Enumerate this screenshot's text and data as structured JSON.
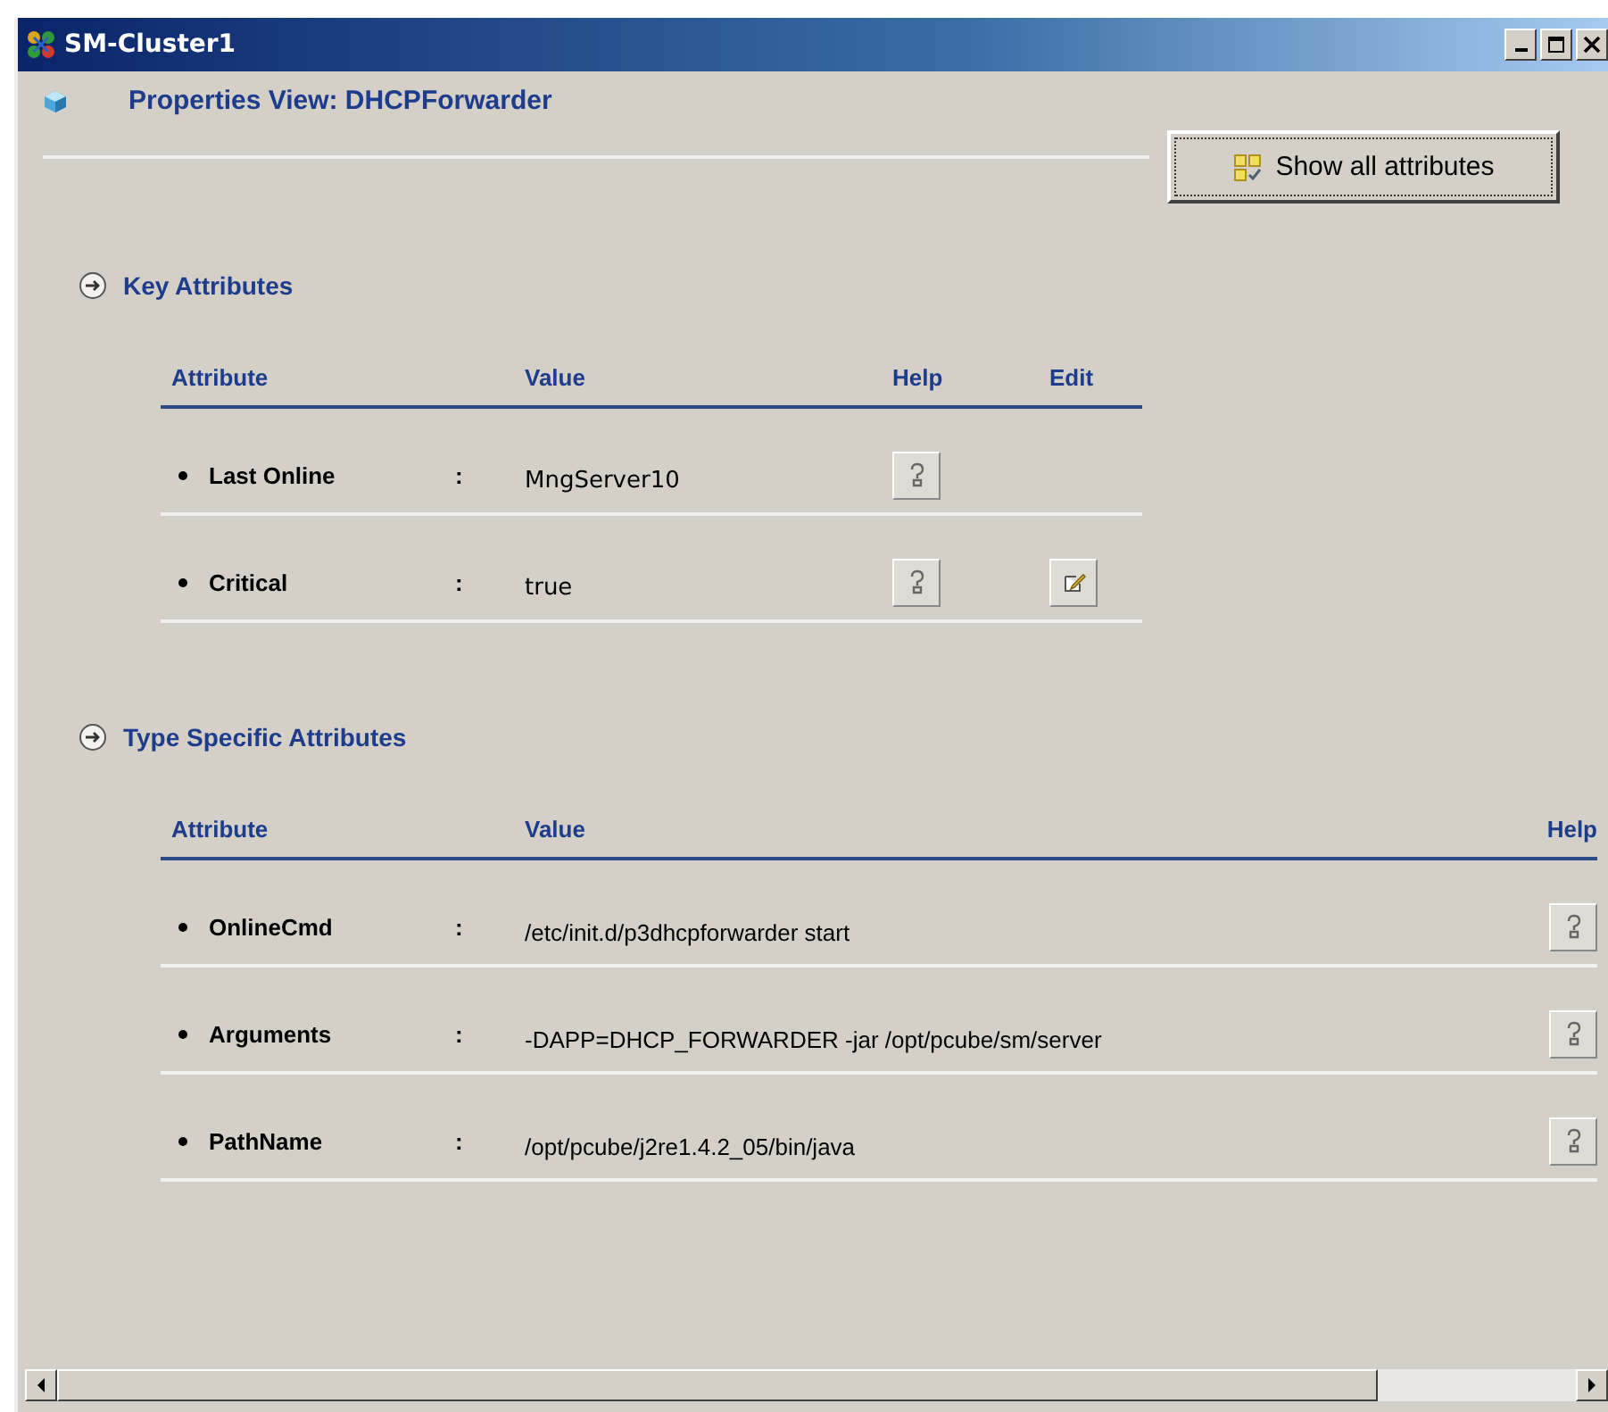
{
  "window": {
    "title": "SM-Cluster1"
  },
  "view_title": "Properties View:  DHCPForwarder",
  "show_all_button": "Show all attributes",
  "sections": [
    {
      "title": "Key Attributes",
      "columns": [
        "Attribute",
        "Value",
        "Help",
        "Edit"
      ],
      "rows": [
        {
          "attribute": "Last Online",
          "separator": ":",
          "value": "MngServer10",
          "editable": false
        },
        {
          "attribute": "Critical",
          "separator": ":",
          "value": "true",
          "editable": true
        }
      ]
    },
    {
      "title": "Type Specific Attributes",
      "columns": [
        "Attribute",
        "Value",
        "Help"
      ],
      "rows": [
        {
          "attribute": "OnlineCmd",
          "separator": ":",
          "value": "/etc/init.d/p3dhcpforwarder start"
        },
        {
          "attribute": "Arguments",
          "separator": ":",
          "value": "-DAPP=DHCP_FORWARDER -jar /opt/pcube/sm/server"
        },
        {
          "attribute": "PathName",
          "separator": ":",
          "value": "/opt/pcube/j2re1.4.2_05/bin/java"
        }
      ]
    }
  ]
}
